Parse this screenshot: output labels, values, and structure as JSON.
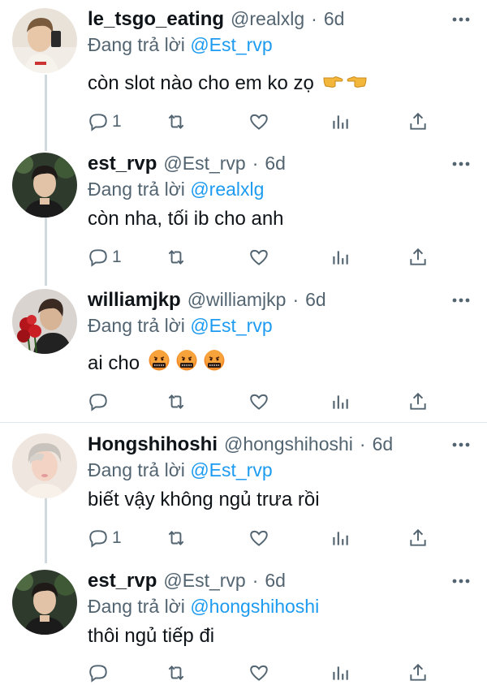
{
  "colors": {
    "accent": "#1d9bf0",
    "secondary_text": "#536471",
    "thread_line": "#cfd9de"
  },
  "reply_prefix": "Đang trả lời",
  "tweets": [
    {
      "display_name": "le_tsgo_eating",
      "handle": "@realxlg",
      "time": "6d",
      "reply_to": "@Est_rvp",
      "text": "còn slot nào cho em ko zọ",
      "emojis": [
        "backhand-index-pointing-right-icon",
        "backhand-index-pointing-left-icon"
      ],
      "reply_count": "1",
      "retweet_count": "",
      "like_count": ""
    },
    {
      "display_name": "est_rvp",
      "handle": "@Est_rvp",
      "time": "6d",
      "reply_to": "@realxlg",
      "text": "còn nha, tối ib cho anh",
      "emojis": [],
      "reply_count": "1",
      "retweet_count": "",
      "like_count": ""
    },
    {
      "display_name": "williamjkp",
      "handle": "@williamjkp",
      "time": "6d",
      "reply_to": "@Est_rvp",
      "text": "ai cho",
      "emojis": [
        "face-with-symbols-on-mouth-icon",
        "face-with-symbols-on-mouth-icon",
        "face-with-symbols-on-mouth-icon"
      ],
      "reply_count": "",
      "retweet_count": "",
      "like_count": ""
    },
    {
      "display_name": "Hongshihoshi",
      "handle": "@hongshihoshi",
      "time": "6d",
      "reply_to": "@Est_rvp",
      "text": "biết vậy không ngủ trưa rồi",
      "emojis": [],
      "reply_count": "1",
      "retweet_count": "",
      "like_count": ""
    },
    {
      "display_name": "est_rvp",
      "handle": "@Est_rvp",
      "time": "6d",
      "reply_to": "@hongshihoshi",
      "text": "thôi ngủ tiếp đi",
      "emojis": [],
      "reply_count": "",
      "retweet_count": "",
      "like_count": ""
    }
  ]
}
